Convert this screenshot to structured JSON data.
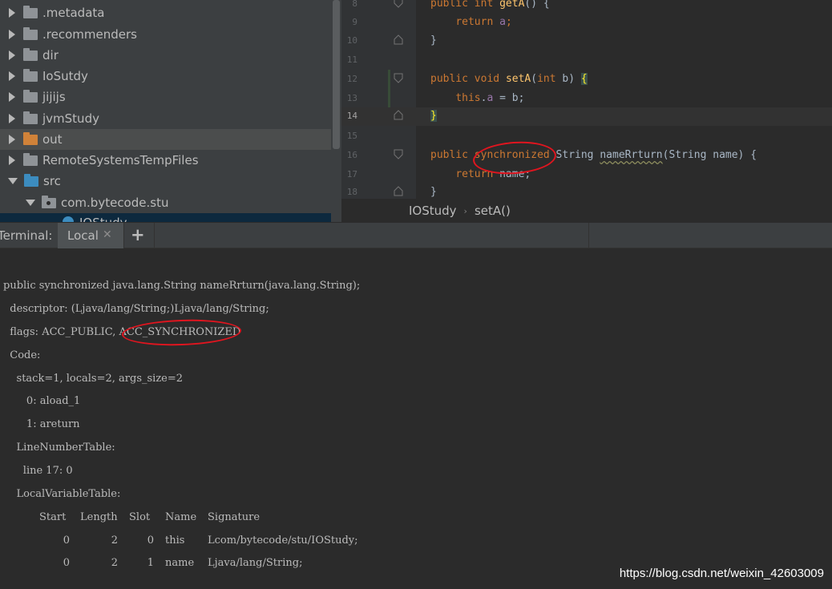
{
  "project_tree": {
    "items": [
      {
        "label": ".metadata",
        "expanded": false
      },
      {
        "label": ".recommenders",
        "expanded": false
      },
      {
        "label": "dir",
        "expanded": false
      },
      {
        "label": "IoSutdy",
        "expanded": false
      },
      {
        "label": "jijijs",
        "expanded": false
      },
      {
        "label": "jvmStudy",
        "expanded": false
      },
      {
        "label": "out",
        "expanded": false
      },
      {
        "label": "RemoteSystemsTempFiles",
        "expanded": false
      },
      {
        "label": "src",
        "expanded": true
      },
      {
        "label": "com.bytecode.stu",
        "expanded": true
      }
    ],
    "partial_item": "IOStudy"
  },
  "editor": {
    "line_numbers": [
      "8",
      "9",
      "10",
      "11",
      "12",
      "13",
      "14",
      "15",
      "16",
      "17",
      "18"
    ],
    "tokens": {
      "public": "public",
      "int": "int",
      "void": "void",
      "return": "return",
      "this": "this",
      "synchronized": "synchronized",
      "getA": "getA",
      "setA": "setA",
      "field_a": "a",
      "sig_getA": "() {",
      "ret_a_end": ";",
      "brace_close": "}",
      "setA_params_pre": "(",
      "setA_params_mid": " b) ",
      "brace_open": "{",
      "assign_mid": " = b;",
      "dot": ".",
      "string_type": " String ",
      "nameRrturn": "nameRrturn",
      "sig_name": "(String name) {",
      "return_name": " name;"
    }
  },
  "breadcrumb": {
    "items": [
      "IOStudy",
      "setA()"
    ],
    "separator": "›"
  },
  "terminal": {
    "title": "Terminal:",
    "tab_label": "Local",
    "close_glyph": "✕",
    "add_glyph": "+",
    "lines": [
      "public synchronized java.lang.String nameRrturn(java.lang.String);",
      "  descriptor: (Ljava/lang/String;)Ljava/lang/String;",
      "  flags: ACC_PUBLIC, ACC_SYNCHRONIZED",
      "  Code:",
      "    stack=1, locals=2, args_size=2",
      "       0: aload_1",
      "       1: areturn",
      "    LineNumberTable:",
      "      line 17: 0",
      "    LocalVariableTable:"
    ],
    "lvt": {
      "headers": [
        "Start",
        "Length",
        "Slot",
        "Name",
        "Signature"
      ],
      "rows": [
        [
          "0",
          "2",
          "0",
          "this",
          "Lcom/bytecode/stu/IOStudy;"
        ],
        [
          "0",
          "2",
          "1",
          "name",
          "Ljava/lang/String;"
        ]
      ]
    }
  },
  "watermark": "https://blog.csdn.net/weixin_42603009",
  "colors": {
    "annotation": "#e0151f",
    "keyword": "#cc7832",
    "method": "#ffc66d",
    "field": "#9876aa"
  }
}
